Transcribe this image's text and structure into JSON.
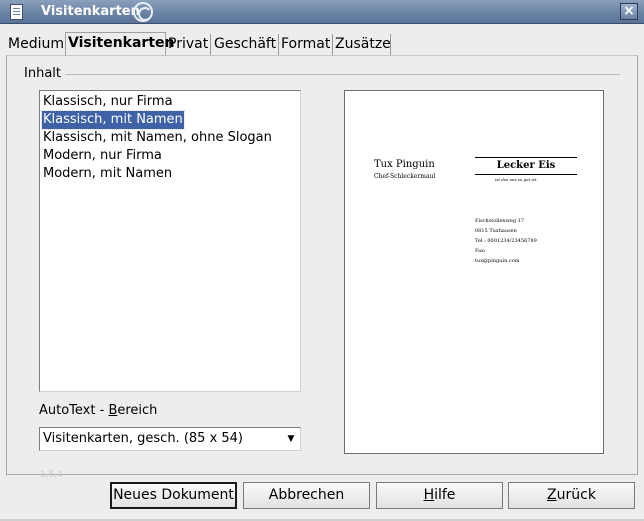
{
  "window": {
    "title": "Visitenkarten",
    "close_glyph": "×"
  },
  "tabs": [
    {
      "label": "Medium"
    },
    {
      "label": "Visitenkarten"
    },
    {
      "label": "Privat"
    },
    {
      "label": "Geschäft"
    },
    {
      "label": "Format"
    },
    {
      "label": "Zusätze"
    }
  ],
  "content": {
    "group_label": "Inhalt",
    "list_items": [
      {
        "label": "Klassisch, nur Firma"
      },
      {
        "label": "Klassisch, mit Namen"
      },
      {
        "label": "Klassisch, mit Namen, ohne Slogan"
      },
      {
        "label": "Modern, nur Firma"
      },
      {
        "label": "Modern, mit Namen"
      }
    ],
    "selected_index": 1
  },
  "preview": {
    "name": "Tux Pinguin",
    "slogan": "Chef-Schleckermaul",
    "company": "Lecker Eis",
    "tagline": "ist das aus so gut ist",
    "address_lines": [
      "Fischstollenweg 17",
      "0815 Tuxhausen",
      "Tel.: 0001234/23456789",
      "Fax:",
      "tux@pinguin.com"
    ]
  },
  "autotext": {
    "label_prefix": "AutoText - ",
    "label_mnemonic": "B",
    "label_rest": "ereich",
    "selected": "Visitenkarten, gesch. (85 x 54)",
    "arrow_glyph": "▼"
  },
  "ghost_text": "1,5,4",
  "buttons": {
    "new_document": "Neues Dokument",
    "cancel": "Abbrechen",
    "help_mnemonic": "H",
    "help_rest": "ilfe",
    "back_mnemonic": "Z",
    "back_rest": "urück"
  }
}
